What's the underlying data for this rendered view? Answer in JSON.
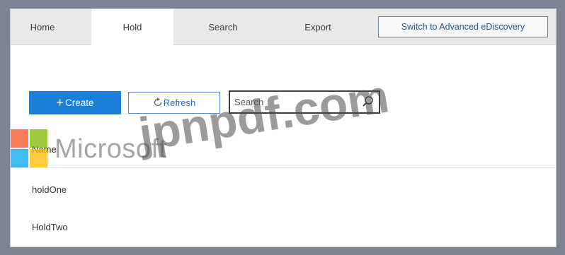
{
  "tabs": [
    {
      "label": "Home",
      "active": false
    },
    {
      "label": "Hold",
      "active": true
    },
    {
      "label": "Search",
      "active": false
    },
    {
      "label": "Export",
      "active": false
    }
  ],
  "switch_button": "Switch to Advanced eDiscovery",
  "toolbar": {
    "create_label": "Create",
    "refresh_label": "Refresh",
    "search_placeholder": "Search"
  },
  "table": {
    "columns": [
      "Name"
    ],
    "rows": [
      "holdOne",
      "HoldTwo"
    ]
  },
  "watermarks": {
    "brand": "Microsoft",
    "site": "jpnpdf.com"
  },
  "colors": {
    "accent": "#1a7fd6",
    "logo_red": "#f25022",
    "logo_green": "#7fba00",
    "logo_blue": "#00a4ef",
    "logo_yellow": "#ffb900"
  },
  "icons": {
    "create": "plus-icon",
    "refresh": "refresh-icon",
    "search": "search-icon"
  }
}
